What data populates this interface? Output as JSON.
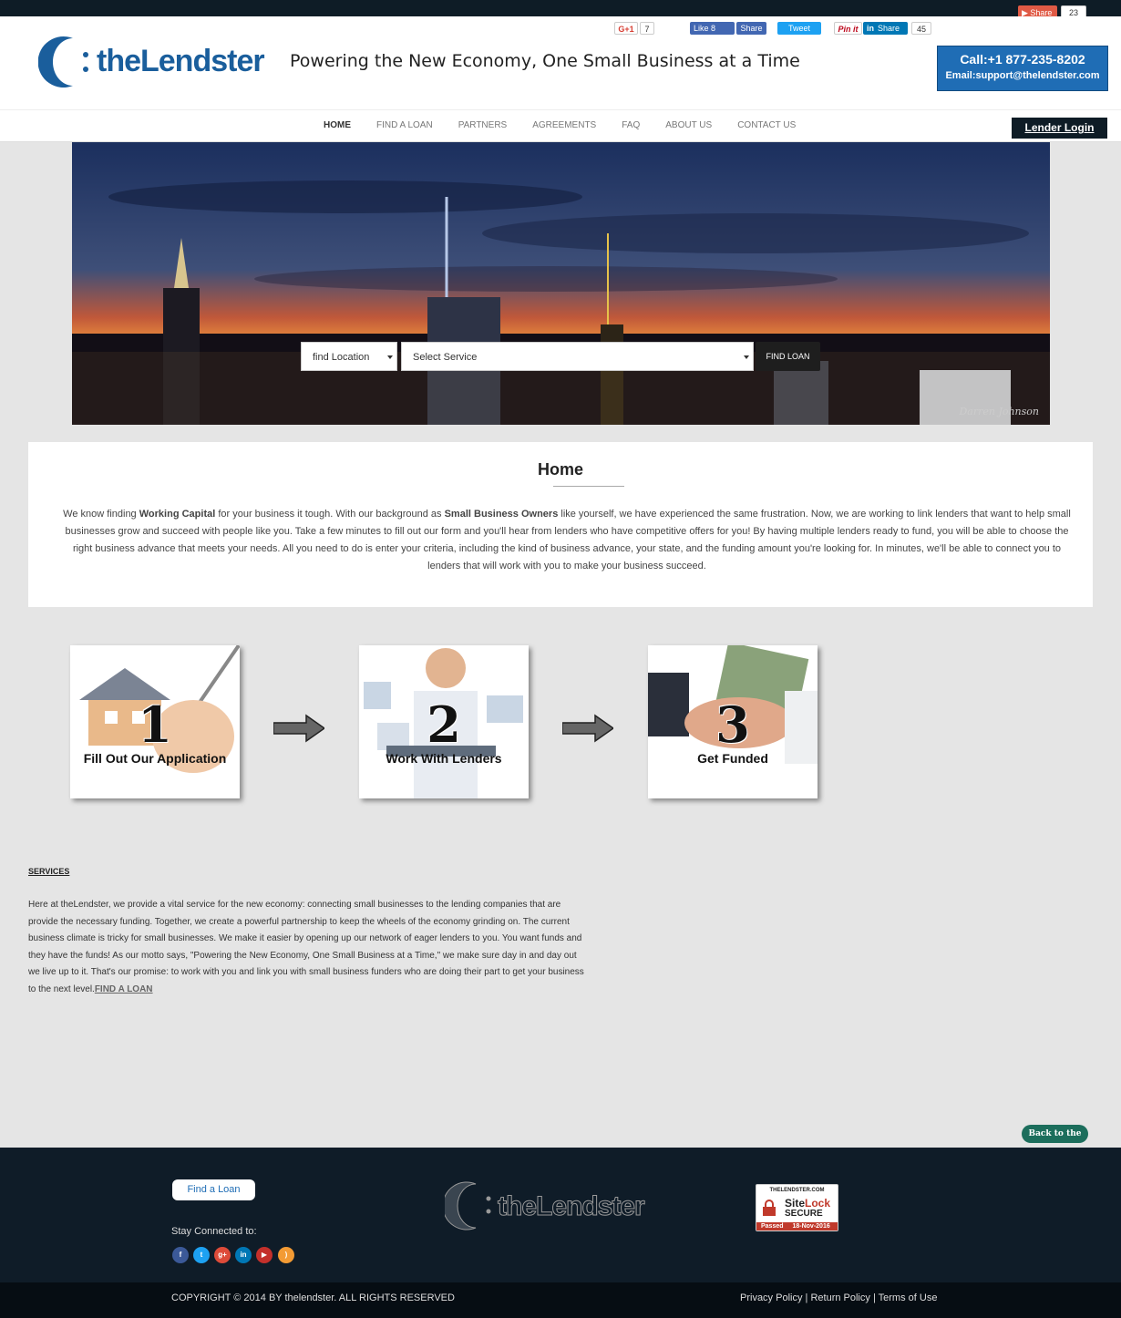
{
  "topbar": {
    "share_label": "Share",
    "share_count": "23"
  },
  "header": {
    "logo_text": "theLendster",
    "tagline": "Powering the New Economy, One Small Business at a Time",
    "gplus_label": "G+1",
    "gplus_count": "7",
    "fb_like_label": "Like 8",
    "fb_share_label": "Share",
    "tweet_label": "Tweet",
    "pinit_label": "Pin it",
    "linkedin_label": "Share",
    "linkedin_count": "45",
    "call": "Call:+1 877-235-8202",
    "email": "Email:support@thelendster.com"
  },
  "nav": {
    "items": [
      "HOME",
      "FIND A LOAN",
      "PARTNERS",
      "AGREEMENTS",
      "FAQ",
      "ABOUT US",
      "CONTACT US"
    ],
    "lender_login": "Lender Login"
  },
  "hero": {
    "location_placeholder": "find Location",
    "service_placeholder": "Select Service",
    "find_button": "FIND LOAN",
    "photo_credit": "Darren Johnson"
  },
  "home": {
    "title": "Home",
    "p_1": "We know finding ",
    "p_2": "Working Capital",
    "p_3": " for your business it tough. With our background as ",
    "p_4": "Small Business Owners",
    "p_5": " like yourself, we have experienced the same frustration. Now, we are working to link lenders that want to help small businesses grow and succeed with people like you. Take a few minutes to fill out our form and you'll hear from lenders who have competitive offers for you! By having multiple lenders ready to fund, you will be able to choose the right business advance that meets your needs. All you need to do is enter your criteria, including the kind of business advance, your state, and the funding amount you're looking for. In minutes, we'll be able to connect you to lenders that will work with you to make your business succeed."
  },
  "steps": [
    {
      "number": "1",
      "label": "Fill Out Our Application"
    },
    {
      "number": "2",
      "label": "Work With Lenders"
    },
    {
      "number": "3",
      "label": "Get Funded"
    }
  ],
  "services": {
    "heading": "SERVICES",
    "text": "Here at theLendster, we provide a vital service for the new economy: connecting small businesses to the lending companies that are provide the necessary funding. Together, we create a powerful partnership to keep the wheels of the economy grinding on. The current business climate is tricky for small businesses. We make it easier by opening up our network of eager lenders to you. You want funds and they have the funds! As our motto says, \"Powering the New Economy, One Small Business at a Time,\" we make sure day in and day out we live up to it. That's our promise: to work with you and link you with small business funders who are doing their part to get your business to the next level.",
    "link": "FIND A LOAN"
  },
  "back_to_top": "Back to the top",
  "footer": {
    "find_loan": "Find a Loan",
    "stay_connected": "Stay Connected to:",
    "logo_text": "theLendster",
    "sitelock_domain": "THELENDSTER.COM",
    "sitelock_name_1": "Site",
    "sitelock_name_2": "Lock",
    "sitelock_secure": "SECURE",
    "sitelock_passed": "Passed",
    "sitelock_date": "18-Nov-2016",
    "copyright": "COPYRIGHT © 2014 BY thelendster. ALL RIGHTS RESERVED",
    "privacy": "Privacy Policy",
    "return": "Return Policy",
    "terms": "Terms of Use",
    "sep": "|"
  },
  "colors": {
    "brand_blue": "#1f6db5",
    "dark_navy": "#0f1c28",
    "light_bg": "#e5e5e5"
  }
}
